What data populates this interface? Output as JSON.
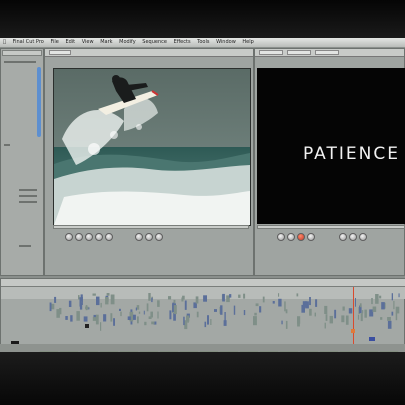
{
  "menu": {
    "items": [
      "Final Cut Pro",
      "File",
      "Edit",
      "View",
      "Mark",
      "Modify",
      "Sequence",
      "Effects",
      "Tools",
      "Window",
      "Help"
    ]
  },
  "canvas": {
    "title_text": "PATIENCE"
  },
  "icons": {
    "apple": "apple-icon",
    "play": "play-icon",
    "surfer_frame": "surfer-video-frame"
  },
  "colors": {
    "menubar": "#d6d8d6",
    "playhead": "#d94a2e",
    "video_clip": "#6f8bc2",
    "audio_clip": "#a5c48f",
    "canvas_background": "#050505"
  }
}
